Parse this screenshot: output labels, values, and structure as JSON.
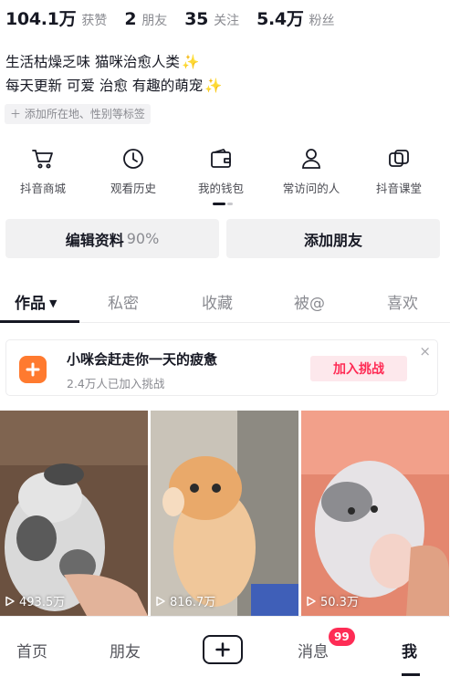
{
  "profile_stats": [
    {
      "value": "104.1万",
      "label": "获赞"
    },
    {
      "value": "2",
      "label": "朋友"
    },
    {
      "value": "35",
      "label": "关注"
    },
    {
      "value": "5.4万",
      "label": "粉丝"
    }
  ],
  "bio": {
    "line1": "生活枯燥乏味 猫咪治愈人类",
    "line2": "每天更新 可爱 治愈 有趣的萌宠",
    "sparkle": "✨"
  },
  "tag_hint": "＋ 添加所在地、性别等标签",
  "tools": [
    {
      "label": "抖音商城",
      "icon": "cart-icon"
    },
    {
      "label": "观看历史",
      "icon": "clock-icon"
    },
    {
      "label": "我的钱包",
      "icon": "wallet-icon"
    },
    {
      "label": "常访问的人",
      "icon": "person-icon"
    },
    {
      "label": "抖音课堂",
      "icon": "classroom-icon"
    }
  ],
  "actions": {
    "edit_label": "编辑资料",
    "edit_percent": "90%",
    "add_friend_label": "添加朋友"
  },
  "tabs": [
    {
      "label": "作品",
      "active": true,
      "caret": "▼"
    },
    {
      "label": "私密"
    },
    {
      "label": "收藏"
    },
    {
      "label": "被@"
    },
    {
      "label": "喜欢"
    }
  ],
  "challenge": {
    "title": "小咪会赶走你一天的疲惫",
    "subtitle": "2.4万人已加入挑战",
    "button": "加入挑战",
    "close": "×"
  },
  "videos": [
    {
      "plays": "493.5万"
    },
    {
      "plays": "816.7万"
    },
    {
      "plays": "50.3万"
    }
  ],
  "bottom_nav": {
    "home": "首页",
    "friends": "朋友",
    "messages": "消息",
    "messages_badge": "99",
    "me": "我"
  },
  "colors": {
    "accent_red": "#fe2c55",
    "challenge_orange": "#ff7a2f",
    "text_primary": "#161823",
    "text_secondary": "#8a8b91"
  }
}
